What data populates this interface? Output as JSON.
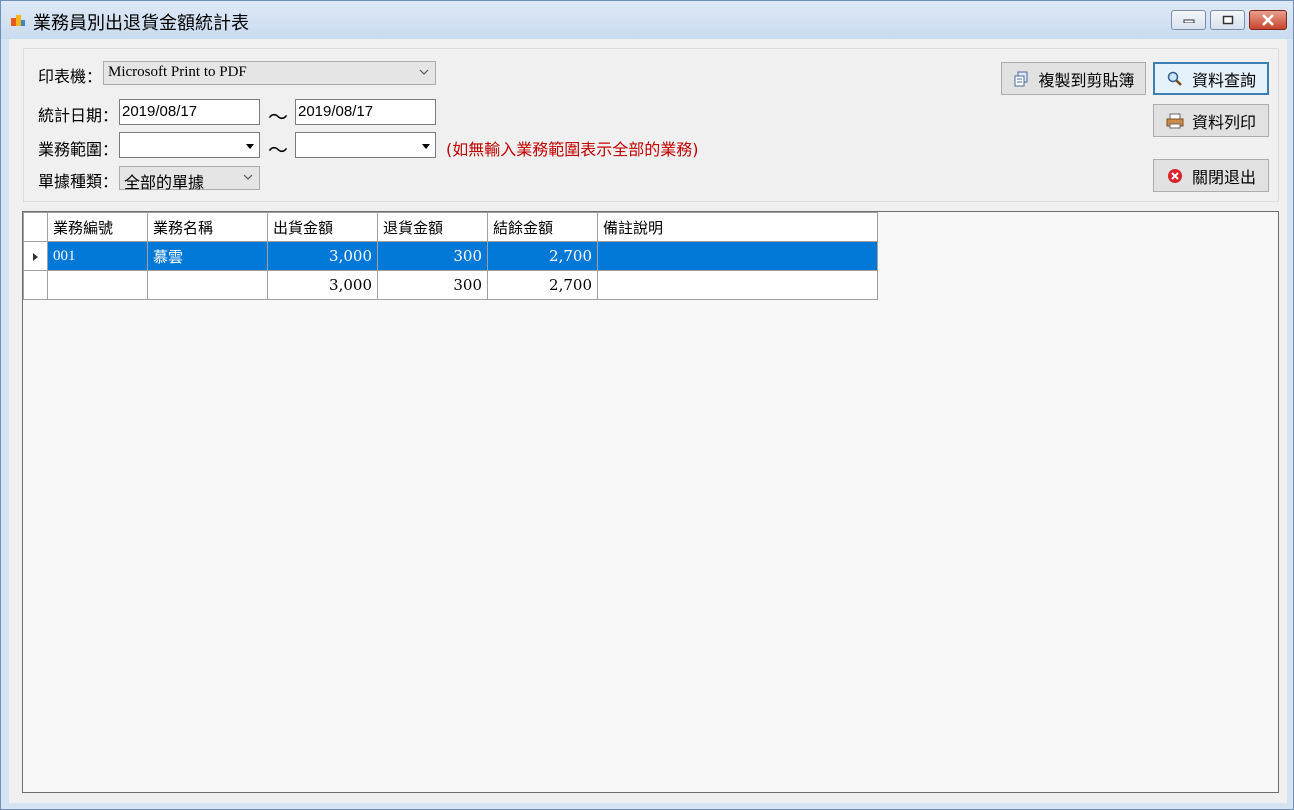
{
  "window": {
    "title": "業務員別出退貨金額統計表"
  },
  "filters": {
    "printer_label": "印表機：",
    "printer_value": "Microsoft Print to PDF",
    "date_label": "統計日期：",
    "date_from": "2019/08/17",
    "date_to": "2019/08/17",
    "range_label": "業務範圍：",
    "range_from": "",
    "range_to": "",
    "range_hint": "(如無輸入業務範圍表示全部的業務)",
    "doctype_label": "單據種類：",
    "doctype_value": "全部的單據",
    "tilde": "～"
  },
  "buttons": {
    "copy": "複製到剪貼簿",
    "query": "資料查詢",
    "print": "資料列印",
    "exit": "關閉退出"
  },
  "table": {
    "columns": [
      "業務編號",
      "業務名稱",
      "出貨金額",
      "退貨金額",
      "結餘金額",
      "備註說明"
    ],
    "rows": [
      {
        "code": "001",
        "name": "慕雲",
        "ship": "3,000",
        "ret": "300",
        "bal": "2,700",
        "note": ""
      },
      {
        "code": "",
        "name": "",
        "ship": "3,000",
        "ret": "300",
        "bal": "2,700",
        "note": ""
      }
    ]
  },
  "colors": {
    "selection": "#0078d7",
    "hint": "#c00000"
  }
}
